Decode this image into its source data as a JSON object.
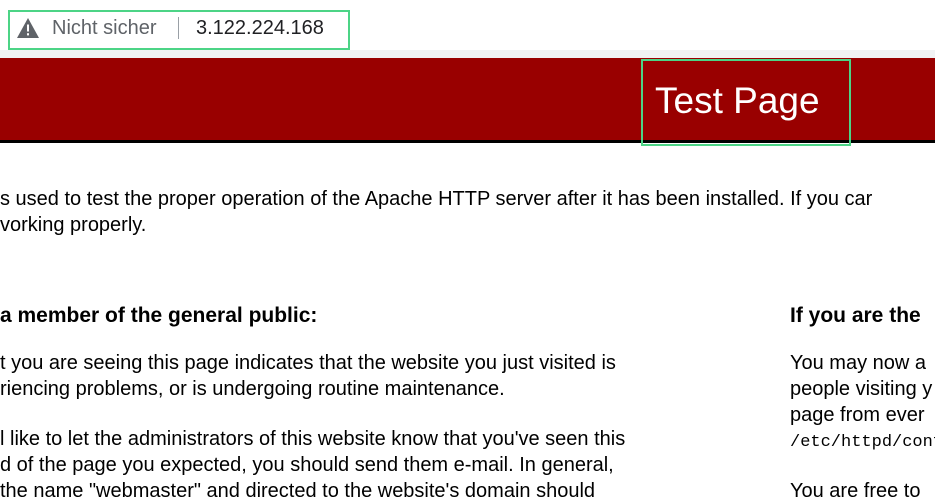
{
  "addressbar": {
    "warning_icon": "warning-triangle-icon",
    "not_secure": "Nicht sicher",
    "url": "3.122.224.168"
  },
  "header": {
    "title": "Test Page",
    "background": "#990000"
  },
  "intro": {
    "line1": "s used to test the proper operation of the Apache HTTP server after it has been installed. If you car",
    "line2": "vorking properly."
  },
  "left": {
    "heading": "a member of the general public:",
    "p1_line1": "t you are seeing this page indicates that the website you just visited is",
    "p1_line2": "riencing problems, or is undergoing routine maintenance.",
    "p2_line1": "l like to let the administrators of this website know that you've seen this",
    "p2_line2": "d of the page you expected, you should send them e-mail. In general,",
    "p2_line3": " the name \"webmaster\" and directed to the website's domain should"
  },
  "right": {
    "heading": "If you are the",
    "p1_line1": "You may now a",
    "p1_line2": "people visiting y",
    "p1_line3": "page from ever",
    "p1_code": "/etc/httpd/conf",
    "p2_line1": "You are free to"
  },
  "colors": {
    "highlight_border": "#4cd486"
  }
}
